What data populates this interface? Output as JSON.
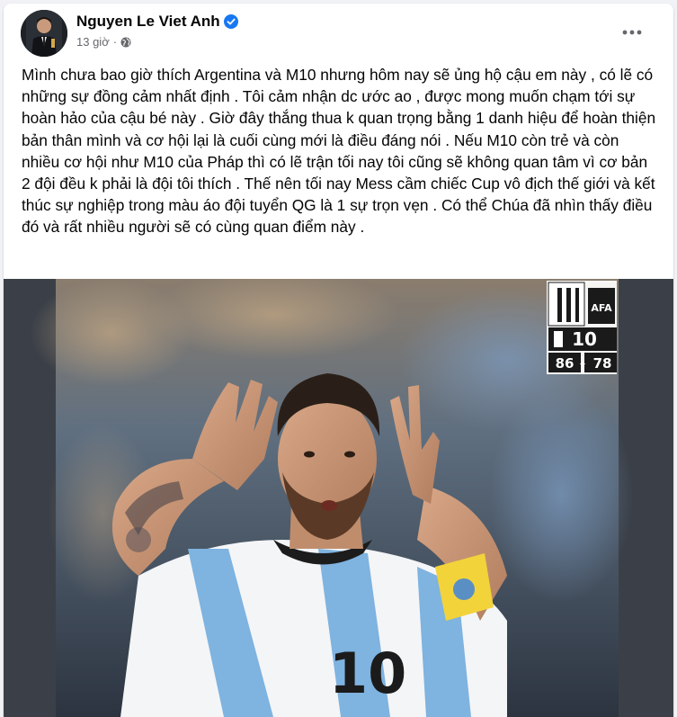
{
  "author": {
    "name": "Nguyen Le Viet Anh",
    "verified": true
  },
  "meta": {
    "time": "13 giờ",
    "separator": "·",
    "audience_icon": "globe-icon"
  },
  "more_icon": "more-options-icon",
  "post_text": "Mình chưa bao giờ thích Argentina và M10 nhưng hôm nay sẽ ủng hộ cậu em này , có lẽ có những sự đồng cảm nhất định . Tôi cảm nhận dc ước ao , được mong muốn chạm tới sự hoàn hảo của cậu bé này . Giờ đây thắng thua k quan trọng bằng 1 danh hiệu để hoàn thiện bản thân mình và cơ hội lại là cuối cùng mới là điều đáng nói . Nếu M10 còn trẻ và còn nhiều cơ hội như M10 của Pháp thì có lẽ trận tối nay tôi cũng sẽ không quan tâm vì cơ bản 2 đội đều k phải là đội tôi thích . Thế nên tối nay Mess cầm chiếc Cup vô địch thế giới và kết thúc sự nghiệp trong màu áo đội tuyển QG là 1 sự trọn vẹn . Có thể Chúa đã nhìn thấy điều đó và rất nhiều người sẽ có cùng quan điểm này .",
  "photo": {
    "badge_number": "10",
    "badge_text_1": "86",
    "badge_text_2": "78",
    "badge_logo": "AFA",
    "jersey_number": "10"
  },
  "colors": {
    "accent": "#1877f2",
    "text": "#050505",
    "secondary": "#65676b",
    "jersey_blue": "#7fb3e0"
  }
}
